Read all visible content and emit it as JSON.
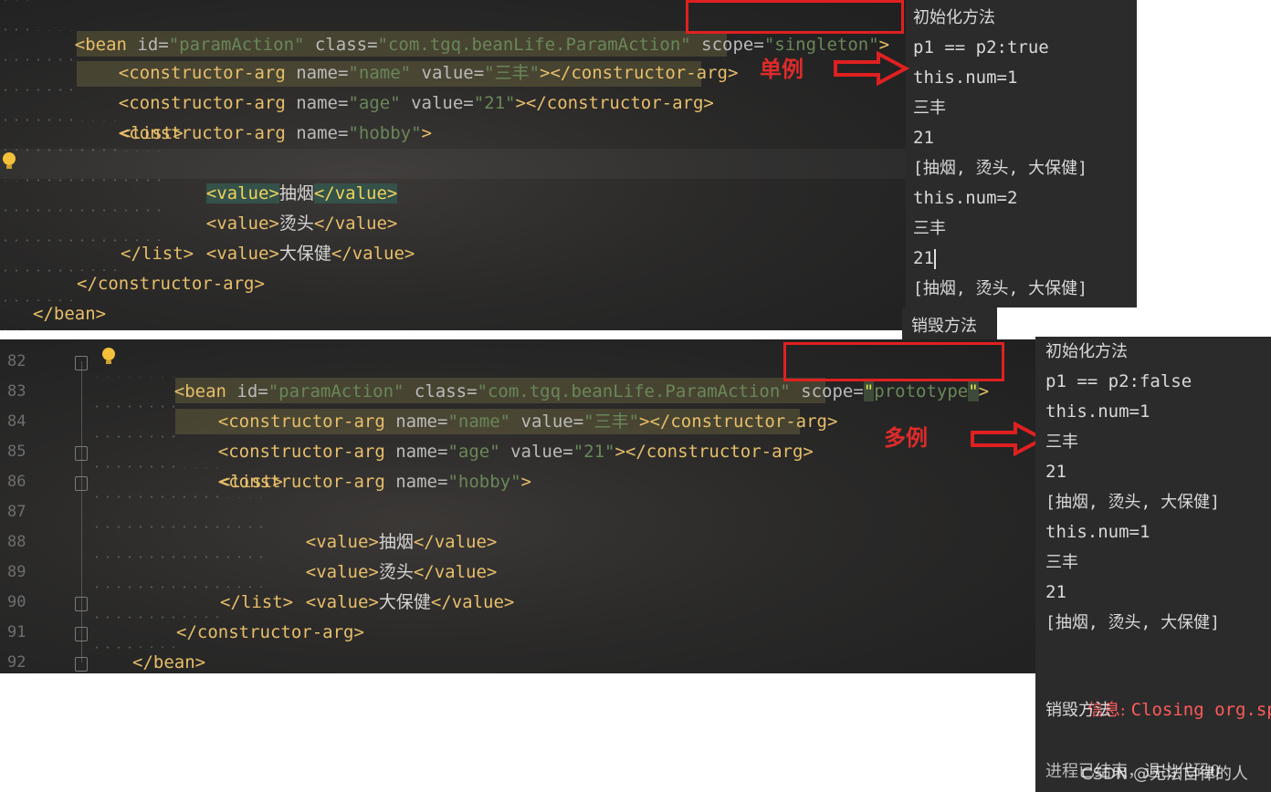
{
  "top_editor": {
    "lines": [
      {
        "open": "<bean ",
        "parts": [
          [
            "attr",
            "id="
          ],
          [
            "str",
            "\"paramAction\""
          ],
          [
            "txt",
            " "
          ],
          [
            "attr",
            "class="
          ],
          [
            "str",
            "\"com.tgq.beanLife.ParamAction\""
          ],
          [
            "txt",
            " "
          ]
        ],
        "scope_attr": "scope=",
        "scope_val": "\"singleton\"",
        "close": ">"
      },
      {
        "text1": "<constructor-arg ",
        "a1": "name=",
        "v1": "\"name\"",
        "a2": " value=",
        "v2": "\"三丰\"",
        "end": "></constructor-arg>"
      },
      {
        "text1": "<constructor-arg ",
        "a1": "name=",
        "v1": "\"age\"",
        "a2": " value=",
        "v2": "\"21\"",
        "end": "></constructor-arg>"
      },
      {
        "text1": "<constructor-arg ",
        "a1": "name=",
        "v1": "\"hobby\"",
        "end": ">"
      },
      {
        "text": "<list>"
      },
      {
        "pre": "<value>",
        "val": "抽烟",
        "post": "</value>"
      },
      {
        "pre": "<value>",
        "val": "烫头",
        "post": "</value>"
      },
      {
        "pre": "<value>",
        "val": "大保健",
        "post": "</value>"
      },
      {
        "text": "</list>"
      },
      {
        "text": "</constructor-arg>"
      },
      {
        "text": "</bean>"
      }
    ]
  },
  "top_console": {
    "lines": [
      "初始化方法",
      "p1 == p2:true",
      "this.num=1",
      "三丰",
      "21",
      "[抽烟, 烫头, 大保健]",
      "this.num=2",
      "三丰",
      "21",
      "[抽烟, 烫头, 大保健]"
    ],
    "destroy": "销毁方法"
  },
  "label_singleton": "单例",
  "label_prototype": "多例",
  "bottom_editor": {
    "line_numbers": [
      "82",
      "83",
      "84",
      "85",
      "86",
      "87",
      "88",
      "89",
      "90",
      "91",
      "92"
    ],
    "scope_attr": "scope=",
    "scope_q1": "\"",
    "scope_val": "prototype",
    "scope_q2": "\"",
    "bean_open": "<bean ",
    "id_attr": "id=",
    "id_val": "\"paramAction\"",
    "class_attr": " class=",
    "class_val": "\"com.tgq.beanLife.ParamAction\"",
    "close": ">"
  },
  "bottom_console": {
    "lines": [
      "初始化方法",
      "p1 == p2:false",
      "this.num=1",
      "三丰",
      "21",
      "[抽烟, 烫头, 大保健]",
      "this.num=1",
      "三丰",
      "21",
      "[抽烟, 烫头, 大保健]"
    ],
    "info_label": "信息: ",
    "info_msg": "Closing org.spri",
    "destroy": "销毁方法",
    "exit": "进程已结束，退出代码0",
    "watermark": "CSDN @无法自律的人"
  },
  "colors": {
    "red": "#e02020",
    "tag": "#e8bf6a",
    "string": "#6a8759",
    "console_bg": "#2b2b2b"
  }
}
